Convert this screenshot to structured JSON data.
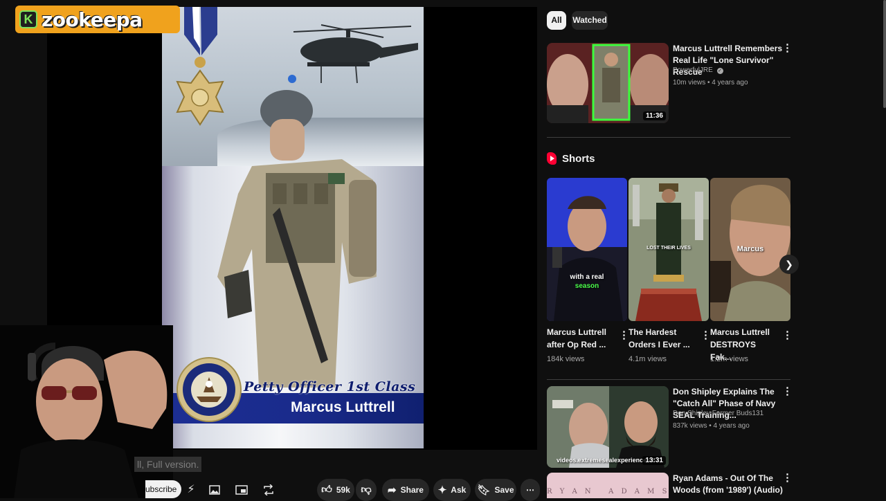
{
  "logo": {
    "badge": "K",
    "text": "zookeepa"
  },
  "poster": {
    "rank": "Petty Officer 1st Class",
    "name": "Marcus Luttrell"
  },
  "player": {
    "caption_fragment": "ll, Full version.",
    "subscribe_label": "ubscribe",
    "like_count": "59k",
    "share_label": "Share",
    "ask_label": "Ask",
    "save_label": "Save"
  },
  "filters": {
    "all": "All",
    "watched": "Watched"
  },
  "videos": [
    {
      "title": "Marcus Luttrell Remembers Real Life \"Lone Survivor\" Rescue",
      "channel": "PowerfulJRE",
      "meta": "10m views • 4 years ago",
      "duration": "11:36"
    },
    {
      "title": "Don Shipley Explains The \"Catch All\" Phase of Navy SEAL Training...",
      "channel": "Don Shipley Former Buds131",
      "meta": "837k views • 4 years ago",
      "duration": "13:31",
      "watermark": "videos.extremesealexperience.co"
    },
    {
      "title": "Ryan Adams - Out Of The Woods (from '1989') (Audio)",
      "thumb_text": "R Y A N   A D A M S"
    }
  ],
  "shorts": {
    "header": "Shorts",
    "items": [
      {
        "title": "Marcus Luttrell after Op Red ...",
        "views": "184k views",
        "overlay1": "with a real",
        "overlay2": "season"
      },
      {
        "title": "The Hardest Orders I Ever ...",
        "views": "4.1m views",
        "overlay1": "LOST THEIR LIVES"
      },
      {
        "title": "Marcus Luttrell DESTROYS Fak...",
        "views": "1.2m views",
        "overlay1": "Marcus"
      }
    ]
  },
  "colors": {
    "background": "#0f0f0f",
    "logo_bg": "#f0a21d",
    "logo_green": "#7ee35b",
    "shorts_red": "#ff0033",
    "poster_band": "#1c2e93"
  }
}
